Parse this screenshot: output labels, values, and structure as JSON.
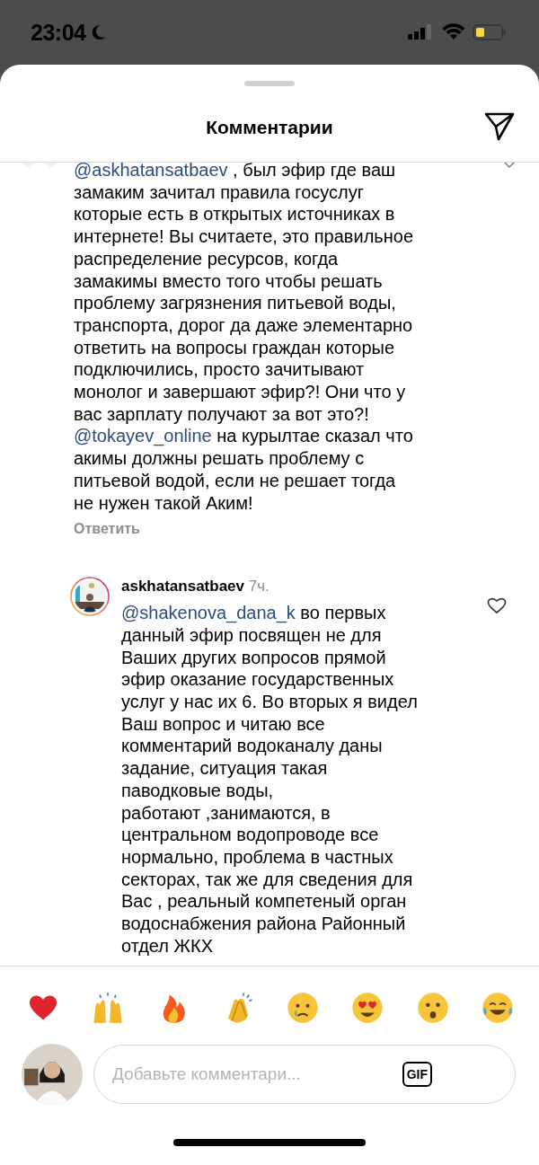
{
  "status_bar": {
    "time": "23:04"
  },
  "header": {
    "title": "Комментарии"
  },
  "comments": [
    {
      "kind": "comment",
      "segments": [
        {
          "kind": "mention",
          "text": "@askhatansatbaev"
        },
        {
          "kind": "text",
          "text": " , был эфир где ваш\nзамаким зачитал правила госуслуг\nкоторые есть в открытых источниках в\nинтернете! Вы считаете, это правильное\nраспределение ресурсов, когда\nзамакимы вместо того чтобы решать\nпроблему  загрязнения питьевой воды,\nтранспорта, дорог да даже элементарно\nответить на вопросы граждан которые\nподключились, просто зачитывают\nмонолог и завершают эфир?! Они что у\nвас зарплату получают за вот это?!\n"
        },
        {
          "kind": "mention",
          "text": "@tokayev_online"
        },
        {
          "kind": "text",
          "text": "  на курылтае сказал что\nакимы должны решать проблему с\nпитьевой водой, если не решает тогда\nне нужен такой Аким!"
        }
      ],
      "reply_label": "Ответить"
    },
    {
      "kind": "reply",
      "username": "askhatansatbaev",
      "time": "7ч.",
      "segments": [
        {
          "kind": "mention",
          "text": "@shakenova_dana_k"
        },
        {
          "kind": "text",
          "text": " во первых\nданный эфир посвящен не для\nВаших других вопросов прямой\nэфир оказание государственных\nуслуг у нас их 6. Во вторых я видел\nВаш вопрос и читаю все\nкомментарий водоканалу даны\nзадание, ситуация такая\nпаводковые воды,\nработают ,занимаются, в\nцентральном водопроводе все\nнормально, проблема в частных\nсекторах, так же для сведения для\nВас , реальный компетеный орган\nводоснабжения района Районный\nотдел ЖКХ"
        }
      ]
    }
  ],
  "reactions": [
    {
      "kind": "heart"
    },
    {
      "kind": "raised-hands"
    },
    {
      "kind": "fire"
    },
    {
      "kind": "clap"
    },
    {
      "kind": "crying"
    },
    {
      "kind": "heart-eyes"
    },
    {
      "kind": "surprised"
    },
    {
      "kind": "laughing"
    }
  ],
  "composer": {
    "placeholder": "Добавьте комментари...",
    "gif_label": "GIF"
  }
}
